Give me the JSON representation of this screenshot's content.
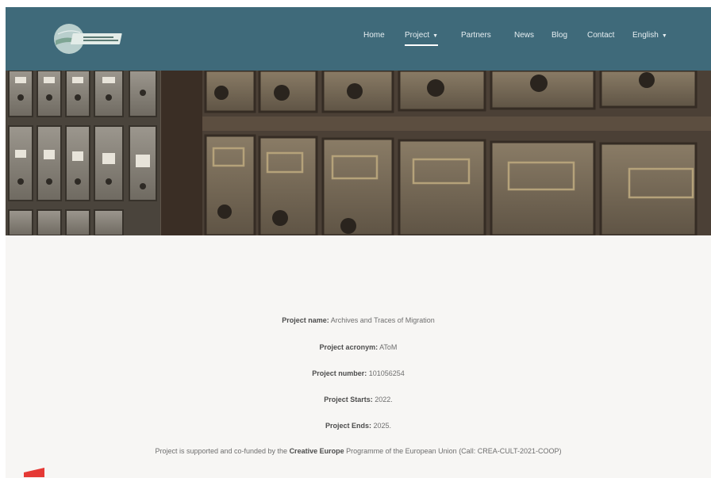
{
  "header": {
    "logo_alt": "Archives and Traces of Migration logo",
    "nav": [
      {
        "label": "Home"
      },
      {
        "label": "Project",
        "has_dropdown": true,
        "active": true
      },
      {
        "label": "Partners"
      },
      {
        "label": "News"
      },
      {
        "label": "Blog"
      },
      {
        "label": "Contact"
      },
      {
        "label": "English",
        "has_dropdown": true
      }
    ]
  },
  "hero": {
    "icon": "archive-card-catalog-drawers-image"
  },
  "project": {
    "name_label": "Project name:",
    "name_value": "Archives and Traces of Migration",
    "acronym_label": "Project acronym:",
    "acronym_value": "AToM",
    "number_label": "Project number:",
    "number_value": "101056254",
    "starts_label": "Project Starts:",
    "starts_value": "2022.",
    "ends_label": "Project Ends:",
    "ends_value": "2025.",
    "support_pre": "Project is supported and co-funded by the",
    "support_bold": "Creative Europe",
    "support_post": "Programme of the European Union (Call: CREA-CULT-2021-COOP)"
  },
  "colors": {
    "header_bg": "#3f6a7a",
    "page_bg": "#f7f6f4",
    "accent_mark": "#e53935"
  }
}
